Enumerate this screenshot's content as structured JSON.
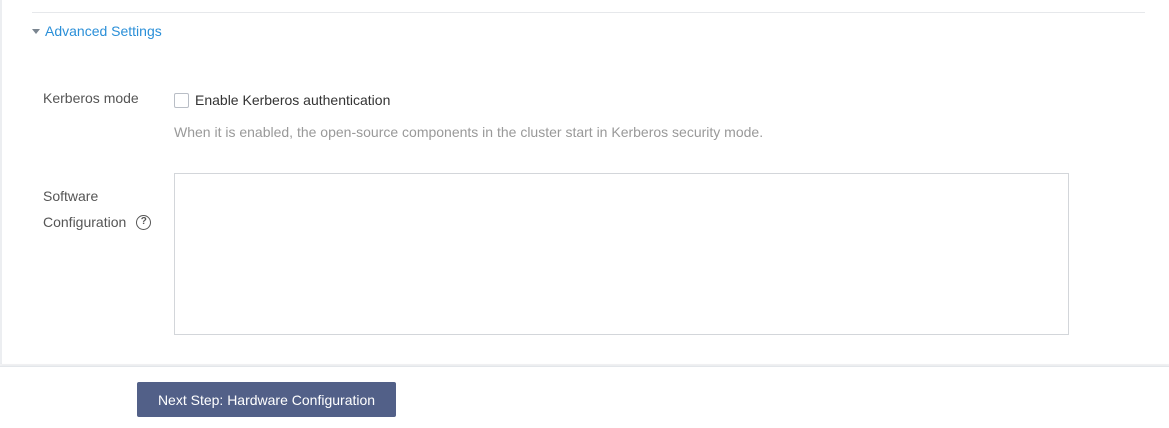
{
  "advanced": {
    "toggle_label": "Advanced Settings",
    "icon": "caret-down-icon",
    "expanded": true
  },
  "kerberos": {
    "label": "Kerberos mode",
    "checkbox_label": "Enable Kerberos authentication",
    "checked": false,
    "hint": "When it is enabled, the open-source components in the cluster start in Kerberos security mode."
  },
  "software": {
    "label_line1": "Software",
    "label_line2": "Configuration",
    "help_icon_glyph": "?",
    "value": ""
  },
  "footer": {
    "next_button": "Next Step: Hardware Configuration"
  },
  "colors": {
    "link": "#2a8fd8",
    "primary_button": "#526088"
  }
}
